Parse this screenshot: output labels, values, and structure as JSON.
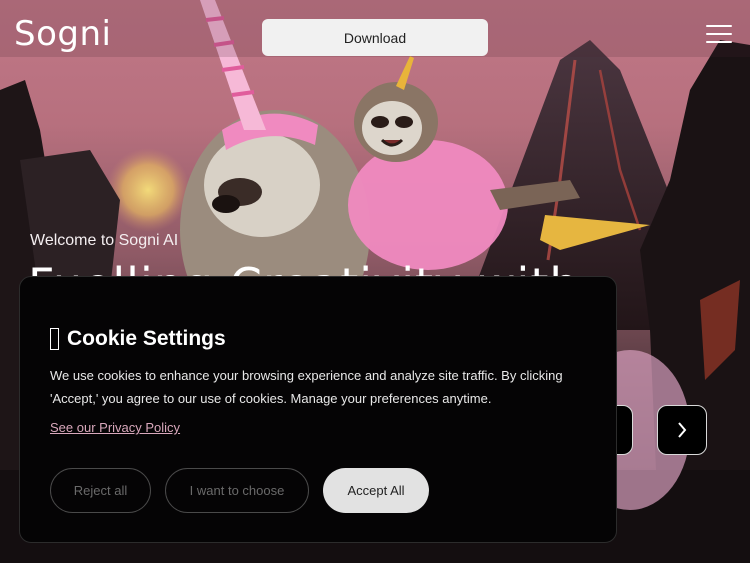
{
  "header": {
    "logo": "Sogni",
    "download_label": "Download"
  },
  "hero": {
    "welcome": "Welcome to Sogni AI",
    "headline": "Fuelling Creativity with"
  },
  "cookie": {
    "title": "Cookie Settings",
    "description": "We use cookies to enhance your browsing experience and analyze site traffic. By clicking 'Accept,' you agree to our use of cookies. Manage your preferences anytime.",
    "privacy_link": "See our Privacy Policy",
    "reject_label": "Reject all",
    "choose_label": "I want to choose",
    "accept_label": "Accept All"
  },
  "icons": {
    "menu": "hamburger-menu-icon",
    "next": "chevron-right-icon",
    "prev": "chevron-left-icon",
    "cookie": "cookie-icon"
  },
  "colors": {
    "sky": "#c07787",
    "panel": "#050405",
    "link": "#d9a8bc",
    "accent_pink": "#f08ac0"
  }
}
